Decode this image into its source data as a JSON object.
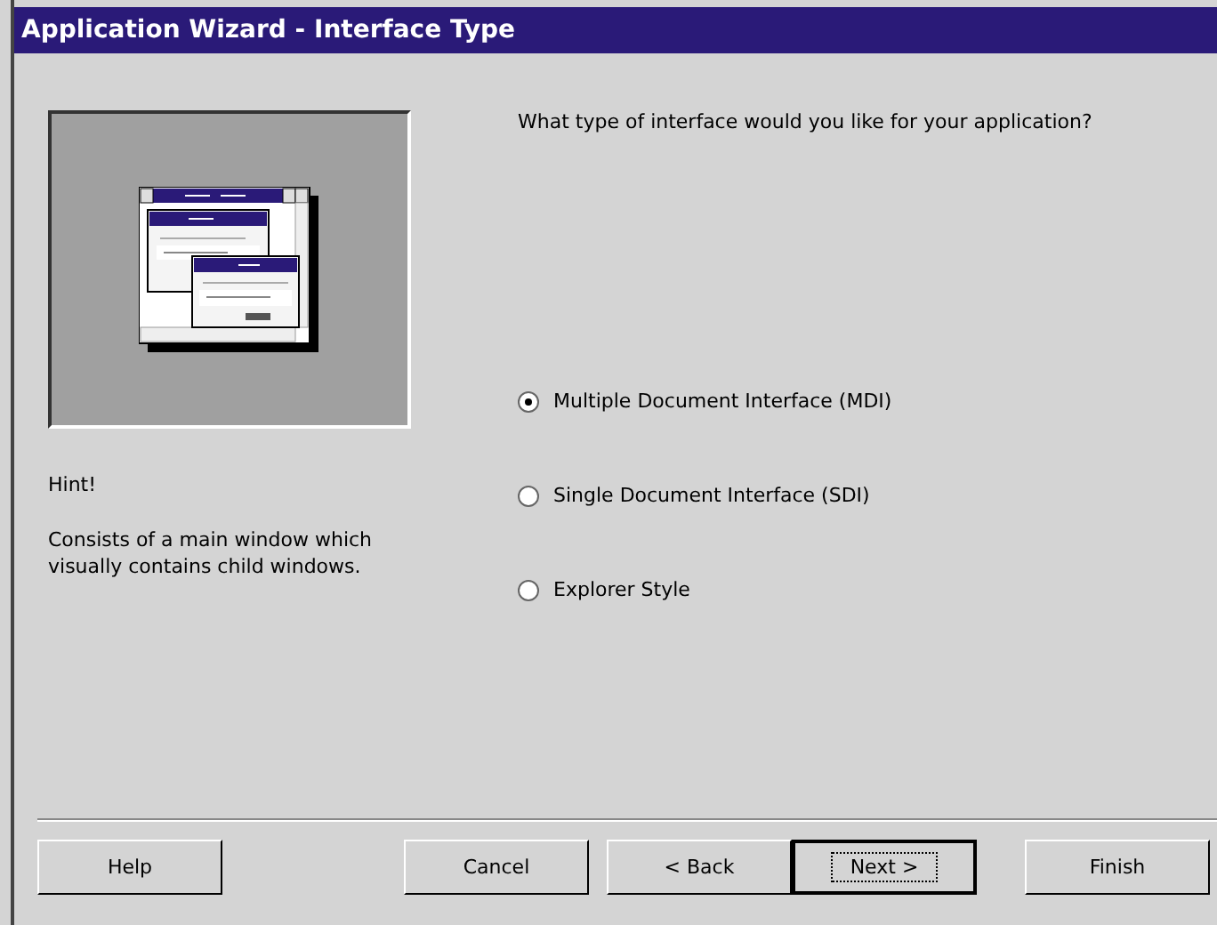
{
  "window": {
    "title": "Application Wizard - Interface Type"
  },
  "question": "What type of interface would you like for your application?",
  "hint": {
    "label": "Hint!",
    "text": "Consists of a main window which visually contains child windows."
  },
  "options": [
    {
      "label": "Multiple Document Interface (MDI)",
      "selected": true
    },
    {
      "label": "Single Document Interface (SDI)",
      "selected": false
    },
    {
      "label": "Explorer Style",
      "selected": false
    }
  ],
  "buttons": [
    {
      "label": "Help",
      "default": false
    },
    {
      "label": "Cancel",
      "default": false
    },
    {
      "label": "< Back",
      "default": false
    },
    {
      "label": "Next >",
      "default": true
    },
    {
      "label": "Finish",
      "default": false
    }
  ]
}
